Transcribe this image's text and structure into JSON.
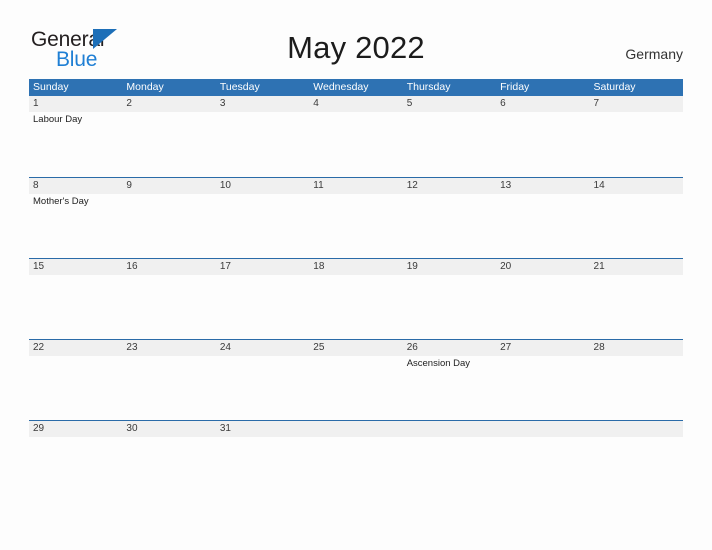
{
  "logo": {
    "word_one": "General",
    "word_two": "Blue",
    "flag_icon": "flag-triangle-icon",
    "accent_color": "#1d6fb8",
    "blue_text_color": "#1f7fd4"
  },
  "header": {
    "title": "May 2022",
    "country": "Germany"
  },
  "theme": {
    "header_blue": "#2e72b3",
    "row_rule_blue": "#2a6ba8",
    "date_band_gray": "#f0f0f0",
    "page_background": "#fdfdfd"
  },
  "calendar": {
    "month": "May",
    "year": "2022",
    "weekdays": [
      "Sunday",
      "Monday",
      "Tuesday",
      "Wednesday",
      "Thursday",
      "Friday",
      "Saturday"
    ],
    "weeks": [
      {
        "days": [
          {
            "date": "1",
            "event": "Labour Day"
          },
          {
            "date": "2",
            "event": ""
          },
          {
            "date": "3",
            "event": ""
          },
          {
            "date": "4",
            "event": ""
          },
          {
            "date": "5",
            "event": ""
          },
          {
            "date": "6",
            "event": ""
          },
          {
            "date": "7",
            "event": ""
          }
        ]
      },
      {
        "days": [
          {
            "date": "8",
            "event": "Mother's Day"
          },
          {
            "date": "9",
            "event": ""
          },
          {
            "date": "10",
            "event": ""
          },
          {
            "date": "11",
            "event": ""
          },
          {
            "date": "12",
            "event": ""
          },
          {
            "date": "13",
            "event": ""
          },
          {
            "date": "14",
            "event": ""
          }
        ]
      },
      {
        "days": [
          {
            "date": "15",
            "event": ""
          },
          {
            "date": "16",
            "event": ""
          },
          {
            "date": "17",
            "event": ""
          },
          {
            "date": "18",
            "event": ""
          },
          {
            "date": "19",
            "event": ""
          },
          {
            "date": "20",
            "event": ""
          },
          {
            "date": "21",
            "event": ""
          }
        ]
      },
      {
        "days": [
          {
            "date": "22",
            "event": ""
          },
          {
            "date": "23",
            "event": ""
          },
          {
            "date": "24",
            "event": ""
          },
          {
            "date": "25",
            "event": ""
          },
          {
            "date": "26",
            "event": "Ascension Day"
          },
          {
            "date": "27",
            "event": ""
          },
          {
            "date": "28",
            "event": ""
          }
        ]
      },
      {
        "days": [
          {
            "date": "29",
            "event": ""
          },
          {
            "date": "30",
            "event": ""
          },
          {
            "date": "31",
            "event": ""
          },
          {
            "date": "",
            "event": ""
          },
          {
            "date": "",
            "event": ""
          },
          {
            "date": "",
            "event": ""
          },
          {
            "date": "",
            "event": ""
          }
        ]
      }
    ]
  }
}
